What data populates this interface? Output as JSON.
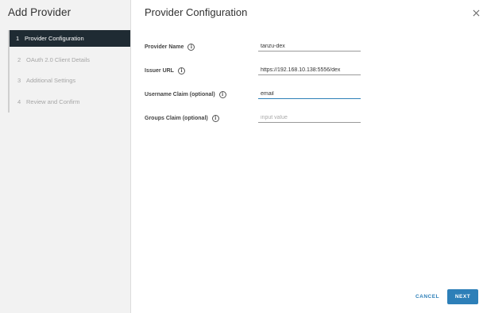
{
  "sidebar": {
    "title": "Add Provider",
    "steps": [
      {
        "num": "1",
        "label": "Provider Configuration"
      },
      {
        "num": "2",
        "label": "OAuth 2.0 Client Details"
      },
      {
        "num": "3",
        "label": "Additional Settings"
      },
      {
        "num": "4",
        "label": "Review and Confirm"
      }
    ],
    "active_step": 1
  },
  "main": {
    "title": "Provider Configuration",
    "fields": {
      "provider_name": {
        "label": "Provider Name",
        "value": "tanzu-dex",
        "placeholder": ""
      },
      "issuer_url": {
        "label": "Issuer URL",
        "value": "https://192.168.10.138:5556/dex",
        "placeholder": ""
      },
      "username_claim": {
        "label": "Username Claim (optional)",
        "value": "email",
        "placeholder": ""
      },
      "groups_claim": {
        "label": "Groups Claim (optional)",
        "value": "",
        "placeholder": "input value"
      }
    }
  },
  "footer": {
    "cancel_label": "CANCEL",
    "next_label": "NEXT"
  },
  "icons": {
    "info": "info-icon",
    "close": "close-icon"
  },
  "colors": {
    "active_step_bg": "#1f2b33",
    "primary": "#2d7fb8",
    "sidebar_bg": "#f2f2f2"
  }
}
